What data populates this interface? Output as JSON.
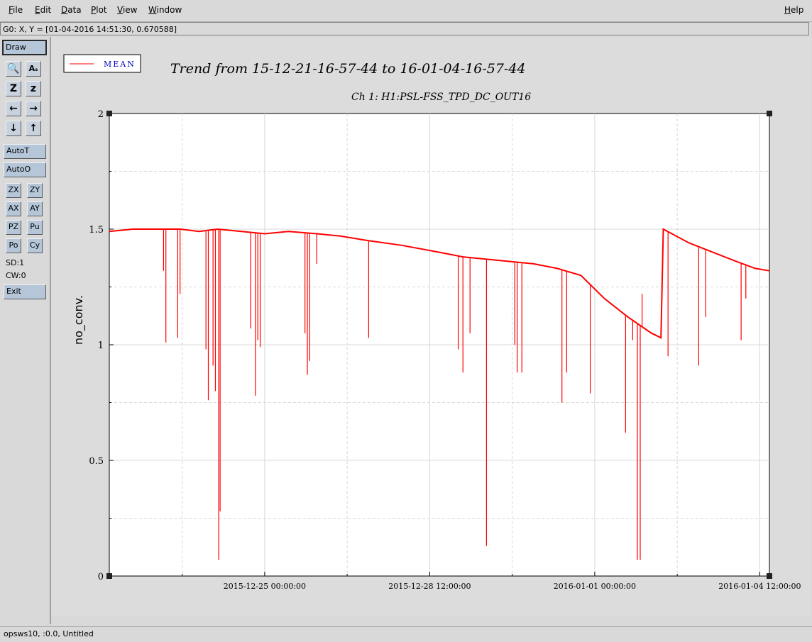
{
  "menu": {
    "file": "File",
    "edit": "Edit",
    "data": "Data",
    "plot": "Plot",
    "view": "View",
    "window": "Window",
    "help": "Help"
  },
  "status_line": "G0: X, Y = [01-04-2016 14:51:30, 0.670588]",
  "sidebar": {
    "draw": "Draw",
    "auto_t": "AutoT",
    "auto_o": "AutoO",
    "zx": "ZX",
    "zy": "ZY",
    "ax": "AX",
    "ay": "AY",
    "pz": "PZ",
    "pu": "Pu",
    "po": "Po",
    "cy": "Cy",
    "sd": "SD:1",
    "cw": "CW:0",
    "exit": "Exit",
    "icon_labels": {
      "zoom_big": "Z",
      "zoom_small": "z",
      "text_tool": "Aₛ"
    }
  },
  "bottom_status": "opsws10, :0.0, Untitled",
  "colors": {
    "series": "#ff0000",
    "legend_text": "#0000c0",
    "button": "#b5c6d9"
  },
  "chart_data": {
    "type": "line",
    "title": "Trend from 15-12-21-16-57-44 to 16-01-04-16-57-44",
    "subtitle": "Ch 1: H1:PSL-FSS_TPD_DC_OUT16",
    "ylabel": "no_conv.",
    "xlabel": "",
    "ylim": [
      0,
      2
    ],
    "yticks": [
      "0",
      "0.5",
      "1",
      "1.5",
      "2"
    ],
    "x_tick_labels": [
      "2015-12-25 00:00:00",
      "2015-12-28 12:00:00",
      "2016-01-01 00:00:00",
      "2016-01-04 12:00:00"
    ],
    "x_tick_days": [
      3.295,
      6.795,
      10.295,
      13.795
    ],
    "x_range_days": [
      0,
      14
    ],
    "grid": true,
    "legend_position": "top-left",
    "series": [
      {
        "name": "MEAN",
        "color": "#ff0000",
        "trend": [
          [
            0.0,
            1.49
          ],
          [
            0.5,
            1.5
          ],
          [
            1.0,
            1.5
          ],
          [
            1.5,
            1.5
          ],
          [
            1.9,
            1.49
          ],
          [
            2.3,
            1.5
          ],
          [
            2.8,
            1.49
          ],
          [
            3.3,
            1.48
          ],
          [
            3.8,
            1.49
          ],
          [
            4.4,
            1.48
          ],
          [
            4.9,
            1.47
          ],
          [
            5.5,
            1.45
          ],
          [
            6.2,
            1.43
          ],
          [
            7.0,
            1.4
          ],
          [
            7.5,
            1.38
          ],
          [
            8.0,
            1.37
          ],
          [
            8.5,
            1.36
          ],
          [
            9.0,
            1.35
          ],
          [
            9.5,
            1.33
          ],
          [
            10.0,
            1.3
          ],
          [
            10.5,
            1.2
          ],
          [
            11.0,
            1.12
          ],
          [
            11.5,
            1.05
          ],
          [
            11.7,
            1.03
          ],
          [
            11.75,
            1.5
          ],
          [
            12.3,
            1.44
          ],
          [
            12.8,
            1.4
          ],
          [
            13.3,
            1.36
          ],
          [
            13.7,
            1.33
          ],
          [
            14.0,
            1.32
          ]
        ],
        "dips": [
          [
            1.15,
            1.32
          ],
          [
            1.2,
            1.01
          ],
          [
            1.45,
            1.03
          ],
          [
            1.5,
            1.22
          ],
          [
            2.05,
            0.98
          ],
          [
            2.1,
            0.76
          ],
          [
            2.2,
            0.91
          ],
          [
            2.25,
            0.8
          ],
          [
            2.32,
            0.07
          ],
          [
            2.35,
            0.28
          ],
          [
            3.0,
            1.07
          ],
          [
            3.1,
            0.78
          ],
          [
            3.15,
            1.02
          ],
          [
            3.2,
            0.99
          ],
          [
            4.15,
            1.05
          ],
          [
            4.2,
            0.87
          ],
          [
            4.25,
            0.93
          ],
          [
            4.4,
            1.35
          ],
          [
            5.5,
            1.03
          ],
          [
            7.4,
            0.98
          ],
          [
            7.5,
            0.88
          ],
          [
            7.65,
            1.05
          ],
          [
            8.0,
            0.13
          ],
          [
            8.6,
            1.0
          ],
          [
            8.65,
            0.88
          ],
          [
            8.75,
            0.88
          ],
          [
            9.6,
            0.75
          ],
          [
            9.7,
            0.88
          ],
          [
            10.2,
            0.79
          ],
          [
            10.95,
            0.62
          ],
          [
            11.1,
            1.02
          ],
          [
            11.2,
            0.07
          ],
          [
            11.26,
            0.07
          ],
          [
            11.3,
            1.22
          ],
          [
            11.85,
            0.95
          ],
          [
            12.5,
            0.91
          ],
          [
            12.65,
            1.12
          ],
          [
            13.4,
            1.02
          ],
          [
            13.5,
            1.2
          ]
        ]
      }
    ]
  }
}
